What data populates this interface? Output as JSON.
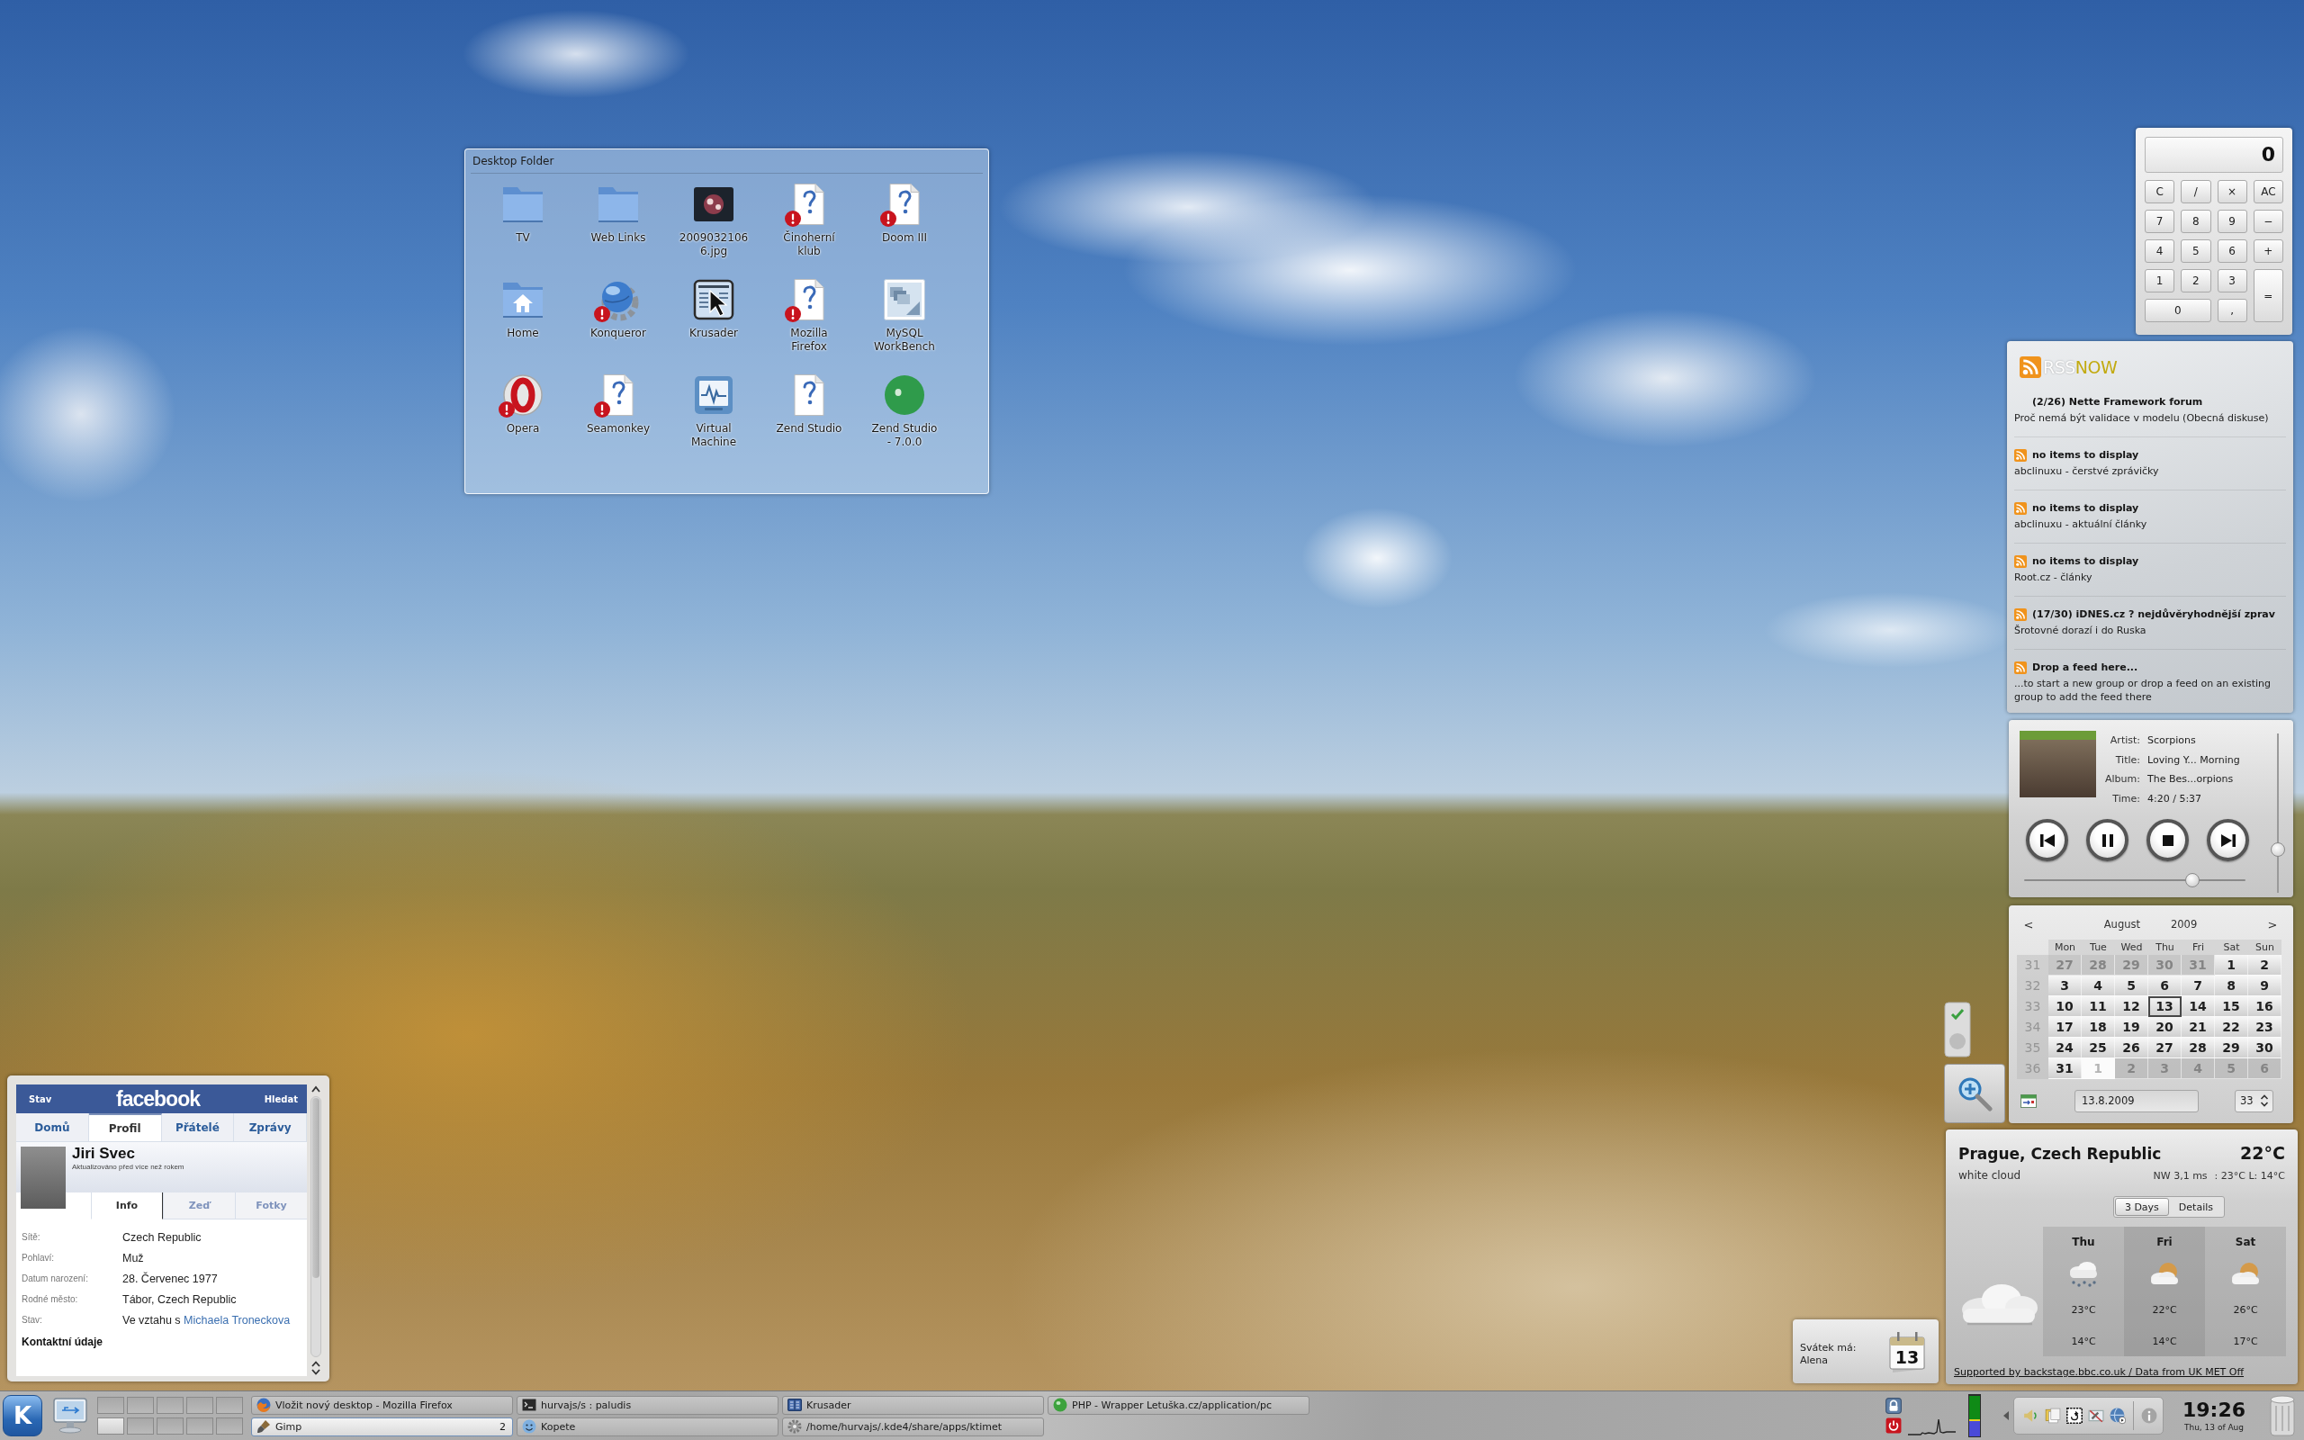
{
  "desktop_folder": {
    "title": "Desktop Folder",
    "items": [
      {
        "label": "TV",
        "kind": "folder",
        "broken": false
      },
      {
        "label": "Web Links",
        "kind": "folder",
        "broken": false
      },
      {
        "label": "20090321066.jpg",
        "kind": "photo",
        "broken": false
      },
      {
        "label": "Činoherní klub",
        "kind": "unknown",
        "broken": true
      },
      {
        "label": "Doom III",
        "kind": "unknown",
        "broken": true
      },
      {
        "label": "Home",
        "kind": "home",
        "broken": false
      },
      {
        "label": "Konqueror",
        "kind": "globe",
        "broken": true
      },
      {
        "label": "Krusader",
        "kind": "pointer",
        "broken": false
      },
      {
        "label": "Mozilla Firefox",
        "kind": "unknown",
        "broken": true
      },
      {
        "label": "MySQL WorkBench",
        "kind": "tiles",
        "broken": false
      },
      {
        "label": "Opera",
        "kind": "ring",
        "broken": true
      },
      {
        "label": "Seamonkey",
        "kind": "unknown",
        "broken": true
      },
      {
        "label": "Virtual Machine",
        "kind": "monitor",
        "broken": false
      },
      {
        "label": "Zend Studio",
        "kind": "unknown",
        "broken": false
      },
      {
        "label": "Zend Studio - 7.0.0",
        "kind": "sphere",
        "broken": false
      }
    ]
  },
  "calculator": {
    "display": "0",
    "keys": [
      {
        "label": "C",
        "kind": "key"
      },
      {
        "label": "/",
        "kind": "key"
      },
      {
        "label": "×",
        "kind": "key"
      },
      {
        "label": "AC",
        "kind": "key"
      },
      {
        "label": "7",
        "kind": "key"
      },
      {
        "label": "8",
        "kind": "key"
      },
      {
        "label": "9",
        "kind": "key"
      },
      {
        "label": "−",
        "kind": "key"
      },
      {
        "label": "4",
        "kind": "key"
      },
      {
        "label": "5",
        "kind": "key"
      },
      {
        "label": "6",
        "kind": "key"
      },
      {
        "label": "+",
        "kind": "key"
      },
      {
        "label": "1",
        "kind": "key"
      },
      {
        "label": "2",
        "kind": "key"
      },
      {
        "label": "3",
        "kind": "key"
      },
      {
        "label": "=",
        "kind": "tall"
      },
      {
        "label": "0",
        "kind": "wide"
      },
      {
        "label": ",",
        "kind": "key"
      }
    ]
  },
  "rss": {
    "logo": [
      "RSS",
      "NOW"
    ],
    "feeds": [
      {
        "title": "(2/26) Nette Framework forum",
        "text": "Proč nemá být validace v modelu (Obecná diskuse)",
        "icon": false
      },
      {
        "title": "no items to display",
        "text": "abclinuxu - čerstvé zprávičky",
        "icon": true
      },
      {
        "title": "no items to display",
        "text": "abclinuxu - aktuální články",
        "icon": true
      },
      {
        "title": "no items to display",
        "text": "Root.cz - články",
        "icon": true
      },
      {
        "title": "(17/30) iDNES.cz ? nejdůvěryhodnější zprav",
        "text": "Šrotovné dorazí i do Ruska",
        "icon": true
      },
      {
        "title": "Drop a feed here...",
        "text": "...to start a new group or drop a feed on an existing group to add the feed there",
        "icon": true
      }
    ]
  },
  "player": {
    "fields": [
      {
        "label": "Artist:",
        "value": "Scorpions"
      },
      {
        "label": "Title:",
        "value": "Loving Y... Morning"
      },
      {
        "label": "Album:",
        "value": "The Bes...orpions"
      },
      {
        "label": "Time:",
        "value": "4:20 / 5:37"
      }
    ],
    "playing": true,
    "position": {
      "level": 0.78
    },
    "volume": {
      "level": 0.25
    }
  },
  "calendar": {
    "prev": "<",
    "month": "August",
    "year": "2009",
    "next": ">",
    "weekdays": [
      "Mon",
      "Tue",
      "Wed",
      "Thu",
      "Fri",
      "Sat",
      "Sun"
    ],
    "weeks": [
      {
        "number": "31",
        "days": [
          {
            "day": "27",
            "other_month": true,
            "selected": false,
            "hovered": false
          },
          {
            "day": "28",
            "other_month": true,
            "selected": false,
            "hovered": false
          },
          {
            "day": "29",
            "other_month": true,
            "selected": false,
            "hovered": false
          },
          {
            "day": "30",
            "other_month": true,
            "selected": false,
            "hovered": false
          },
          {
            "day": "31",
            "other_month": true,
            "selected": false,
            "hovered": false
          },
          {
            "day": "1",
            "other_month": false,
            "selected": false,
            "hovered": false
          },
          {
            "day": "2",
            "other_month": false,
            "selected": false,
            "hovered": false
          }
        ]
      },
      {
        "number": "32",
        "days": [
          {
            "day": "3",
            "other_month": false,
            "selected": false,
            "hovered": false
          },
          {
            "day": "4",
            "other_month": false,
            "selected": false,
            "hovered": false
          },
          {
            "day": "5",
            "other_month": false,
            "selected": false,
            "hovered": false
          },
          {
            "day": "6",
            "other_month": false,
            "selected": false,
            "hovered": false
          },
          {
            "day": "7",
            "other_month": false,
            "selected": false,
            "hovered": false
          },
          {
            "day": "8",
            "other_month": false,
            "selected": false,
            "hovered": false
          },
          {
            "day": "9",
            "other_month": false,
            "selected": false,
            "hovered": false
          }
        ]
      },
      {
        "number": "33",
        "days": [
          {
            "day": "10",
            "other_month": false,
            "selected": false,
            "hovered": false
          },
          {
            "day": "11",
            "other_month": false,
            "selected": false,
            "hovered": false
          },
          {
            "day": "12",
            "other_month": false,
            "selected": false,
            "hovered": false
          },
          {
            "day": "13",
            "other_month": false,
            "selected": true,
            "hovered": false
          },
          {
            "day": "14",
            "other_month": false,
            "selected": false,
            "hovered": false
          },
          {
            "day": "15",
            "other_month": false,
            "selected": false,
            "hovered": false
          },
          {
            "day": "16",
            "other_month": false,
            "selected": false,
            "hovered": false
          }
        ]
      },
      {
        "number": "34",
        "days": [
          {
            "day": "17",
            "other_month": false,
            "selected": false,
            "hovered": false
          },
          {
            "day": "18",
            "other_month": false,
            "selected": false,
            "hovered": false
          },
          {
            "day": "19",
            "other_month": false,
            "selected": false,
            "hovered": false
          },
          {
            "day": "20",
            "other_month": false,
            "selected": false,
            "hovered": false
          },
          {
            "day": "21",
            "other_month": false,
            "selected": false,
            "hovered": false
          },
          {
            "day": "22",
            "other_month": false,
            "selected": false,
            "hovered": false
          },
          {
            "day": "23",
            "other_month": false,
            "selected": false,
            "hovered": false
          }
        ]
      },
      {
        "number": "35",
        "days": [
          {
            "day": "24",
            "other_month": false,
            "selected": false,
            "hovered": false
          },
          {
            "day": "25",
            "other_month": false,
            "selected": false,
            "hovered": false
          },
          {
            "day": "26",
            "other_month": false,
            "selected": false,
            "hovered": false
          },
          {
            "day": "27",
            "other_month": false,
            "selected": false,
            "hovered": false
          },
          {
            "day": "28",
            "other_month": false,
            "selected": false,
            "hovered": false
          },
          {
            "day": "29",
            "other_month": false,
            "selected": false,
            "hovered": false
          },
          {
            "day": "30",
            "other_month": false,
            "selected": false,
            "hovered": false
          }
        ]
      },
      {
        "number": "36",
        "days": [
          {
            "day": "31",
            "other_month": false,
            "selected": false,
            "hovered": false
          },
          {
            "day": "1",
            "other_month": true,
            "selected": false,
            "hovered": true
          },
          {
            "day": "2",
            "other_month": true,
            "selected": false,
            "hovered": false
          },
          {
            "day": "3",
            "other_month": true,
            "selected": false,
            "hovered": false
          },
          {
            "day": "4",
            "other_month": true,
            "selected": false,
            "hovered": false
          },
          {
            "day": "5",
            "other_month": true,
            "selected": false,
            "hovered": false
          },
          {
            "day": "6",
            "other_month": true,
            "selected": false,
            "hovered": false
          }
        ]
      }
    ],
    "date_field": "13.8.2009",
    "week_field": "33"
  },
  "weather": {
    "location": "Prague, Czech Republic",
    "temperature": "22°C",
    "condition": "white cloud",
    "wind": "NW 3,1 ms",
    "high_low": ": 23°C L: 14°C",
    "tabs": [
      {
        "label": "3 Days",
        "selected": true
      },
      {
        "label": "Details",
        "selected": false
      }
    ],
    "forecast": [
      {
        "day": "Thu",
        "kind": "rain",
        "high": "23°C",
        "low": "14°C"
      },
      {
        "day": "Fri",
        "kind": "partly",
        "high": "22°C",
        "low": "14°C"
      },
      {
        "day": "Sat",
        "kind": "partly",
        "high": "26°C",
        "low": "17°C"
      }
    ],
    "footer": "Supported by backstage.bbc.co.uk / Data from UK MET Off"
  },
  "name_day": {
    "label": "Svátek má:",
    "name": "Alena",
    "day": "13"
  },
  "facebook": {
    "header_left": "Stav",
    "logo": "facebook",
    "header_right": "Hledat",
    "tabs": [
      {
        "label": "Domů",
        "selected": false
      },
      {
        "label": "Profil",
        "selected": true
      },
      {
        "label": "Přátelé",
        "selected": false
      },
      {
        "label": "Zprávy",
        "selected": false
      }
    ],
    "profile": {
      "name": "Jiri Svec",
      "updated": "Aktualizováno před více než rokem"
    },
    "subtabs": [
      {
        "label": "Info",
        "selected": true
      },
      {
        "label": "Zeď",
        "selected": false
      },
      {
        "label": "Fotky",
        "selected": false
      }
    ],
    "info": [
      {
        "label": "Sítě:",
        "value": "Czech Republic"
      },
      {
        "label": "Pohlaví:",
        "value": "Muž"
      },
      {
        "label": "Datum narození:",
        "value": "28. Červenec 1977"
      },
      {
        "label": "Rodné město:",
        "value": "Tábor, Czech Republic"
      },
      {
        "label": "Stav:",
        "value": "Ve vztahu s",
        "link": "Michaela Troneckova"
      }
    ],
    "section": "Kontaktní údaje"
  },
  "taskbar": {
    "launcher": "K",
    "pager": [
      {
        "selected": false
      },
      {
        "selected": false
      },
      {
        "selected": false
      },
      {
        "selected": false
      },
      {
        "selected": false
      },
      {
        "selected": true
      },
      {
        "selected": false
      },
      {
        "selected": false
      },
      {
        "selected": false
      },
      {
        "selected": false
      }
    ],
    "tasks": [
      {
        "label": "Vložit nový desktop - Mozilla Firefox",
        "kind": "browser",
        "selected": false
      },
      {
        "label": "hurvajs/s : paludis",
        "kind": "terminal",
        "selected": false
      },
      {
        "label": "Krusader",
        "kind": "filemanager",
        "selected": false
      },
      {
        "label": "PHP - Wrapper Letuška.cz/application/pc",
        "kind": "web",
        "selected": false
      },
      {
        "label": "Gimp",
        "kind": "paint",
        "count": "2",
        "selected": true
      },
      {
        "label": "Kopete",
        "kind": "chat",
        "selected": false
      },
      {
        "label": "/home/hurvajs/.kde4/share/apps/ktimet",
        "kind": "gear",
        "selected": false
      }
    ],
    "clock": {
      "time": "19:26",
      "date": "Thu, 13 of Aug"
    }
  }
}
